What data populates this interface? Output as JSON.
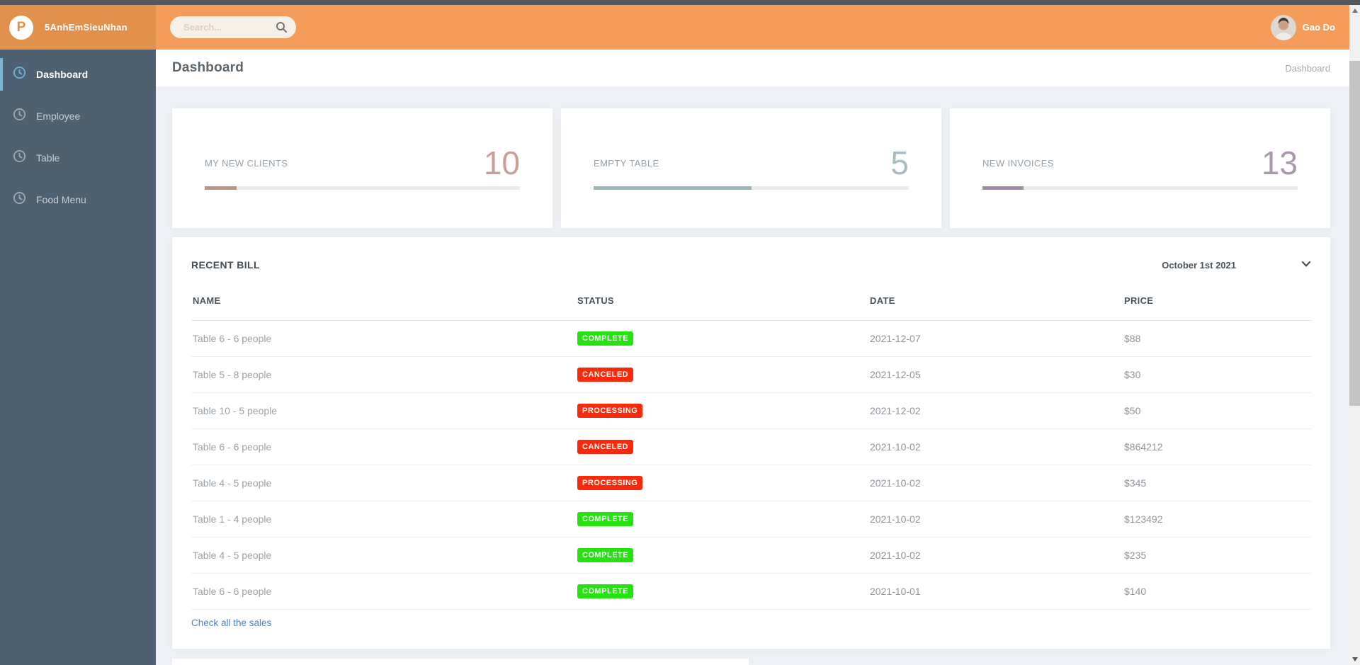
{
  "brand": {
    "logo_letter": "P",
    "name": "5AnhEmSieuNhan"
  },
  "topbar": {
    "search_placeholder": "Search...",
    "user_name": "Gao Do"
  },
  "sidebar": {
    "items": [
      {
        "label": "Dashboard",
        "active": true
      },
      {
        "label": "Employee",
        "active": false
      },
      {
        "label": "Table",
        "active": false
      },
      {
        "label": "Food Menu",
        "active": false
      }
    ]
  },
  "page": {
    "title": "Dashboard",
    "breadcrumb": "Dashboard"
  },
  "stat_cards": [
    {
      "label": "MY NEW CLIENTS",
      "value": "10",
      "progress_percent": 10,
      "accent_color": "#c7a199",
      "bar_color": "#bd9389"
    },
    {
      "label": "EMPTY TABLE",
      "value": "5",
      "progress_percent": 50,
      "accent_color": "#a6bdbf",
      "bar_color": "#9cb7b9"
    },
    {
      "label": "NEW INVOICES",
      "value": "13",
      "progress_percent": 13,
      "accent_color": "#a997ab",
      "bar_color": "#a28ba6"
    }
  ],
  "recent_bill": {
    "title": "RECENT BILL",
    "date_filter": "October 1st 2021",
    "columns": [
      "NAME",
      "STATUS",
      "DATE",
      "PRICE"
    ],
    "rows": [
      {
        "name": "Table 6 - 6 people",
        "status": "COMPLETE",
        "date": "2021-12-07",
        "price": "$88"
      },
      {
        "name": "Table 5 - 8 people",
        "status": "CANCELED",
        "date": "2021-12-05",
        "price": "$30"
      },
      {
        "name": "Table 10 - 5 people",
        "status": "PROCESSING",
        "date": "2021-12-02",
        "price": "$50"
      },
      {
        "name": "Table 6 - 6 people",
        "status": "CANCELED",
        "date": "2021-10-02",
        "price": "$864212"
      },
      {
        "name": "Table 4 - 5 people",
        "status": "PROCESSING",
        "date": "2021-10-02",
        "price": "$345"
      },
      {
        "name": "Table 1 - 4 people",
        "status": "COMPLETE",
        "date": "2021-10-02",
        "price": "$123492"
      },
      {
        "name": "Table 4 - 5 people",
        "status": "COMPLETE",
        "date": "2021-10-02",
        "price": "$235"
      },
      {
        "name": "Table 6 - 6 people",
        "status": "COMPLETE",
        "date": "2021-10-01",
        "price": "$140"
      }
    ],
    "status_colors": {
      "COMPLETE": "#25e30e",
      "CANCELED": "#f9290b",
      "PROCESSING": "#f9290b"
    },
    "footer_link": "Check all the sales"
  },
  "icons": {
    "search": "magnifier",
    "sidebar_item": "clock",
    "date_filter": "chevron-down",
    "scrollbar": [
      "triangle-up",
      "triangle-down"
    ]
  },
  "theme": {
    "header_orange": "#f49d5b",
    "brand_orange": "#e1914c",
    "sidebar_bg": "#4e6171",
    "active_accent": "#7db4d8",
    "link_color": "#4b7fd5",
    "status_green": "#25e30e",
    "status_red": "#f9290b"
  }
}
